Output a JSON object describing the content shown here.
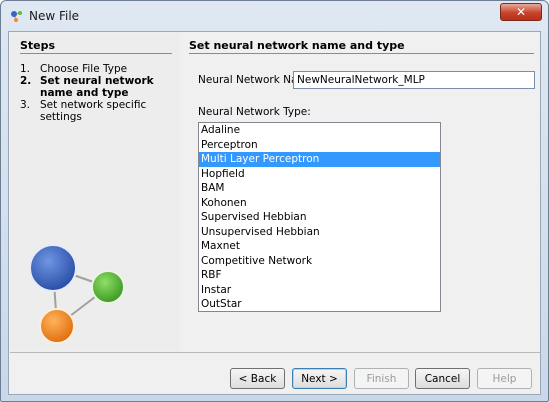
{
  "window": {
    "title": "New File",
    "close_label": "✕"
  },
  "steps": {
    "title": "Steps",
    "items": [
      {
        "num": "1.",
        "label": "Choose File Type"
      },
      {
        "num": "2.",
        "label": "Set neural network name and type"
      },
      {
        "num": "3.",
        "label": "Set network specific settings"
      }
    ],
    "current_index": 1
  },
  "main": {
    "title": "Set neural network name and type",
    "name_label": "Neural Network Name:",
    "name_value": "NewNeuralNetwork_MLP",
    "type_label": "Neural Network Type:",
    "types": [
      "Adaline",
      "Perceptron",
      "Multi Layer Perceptron",
      "Hopfield",
      "BAM",
      "Kohonen",
      "Supervised Hebbian",
      "Unsupervised Hebbian",
      "Maxnet",
      "Competitive Network",
      "RBF",
      "Instar",
      "OutStar"
    ],
    "selected_type": "Multi Layer Perceptron"
  },
  "buttons": {
    "back": "< Back",
    "next": "Next >",
    "finish": "Finish",
    "cancel": "Cancel",
    "help": "Help"
  },
  "colors": {
    "selection": "#3399ff",
    "node_blue": "#3b64c4",
    "node_green": "#5cbf3a",
    "node_orange": "#f08a24"
  }
}
